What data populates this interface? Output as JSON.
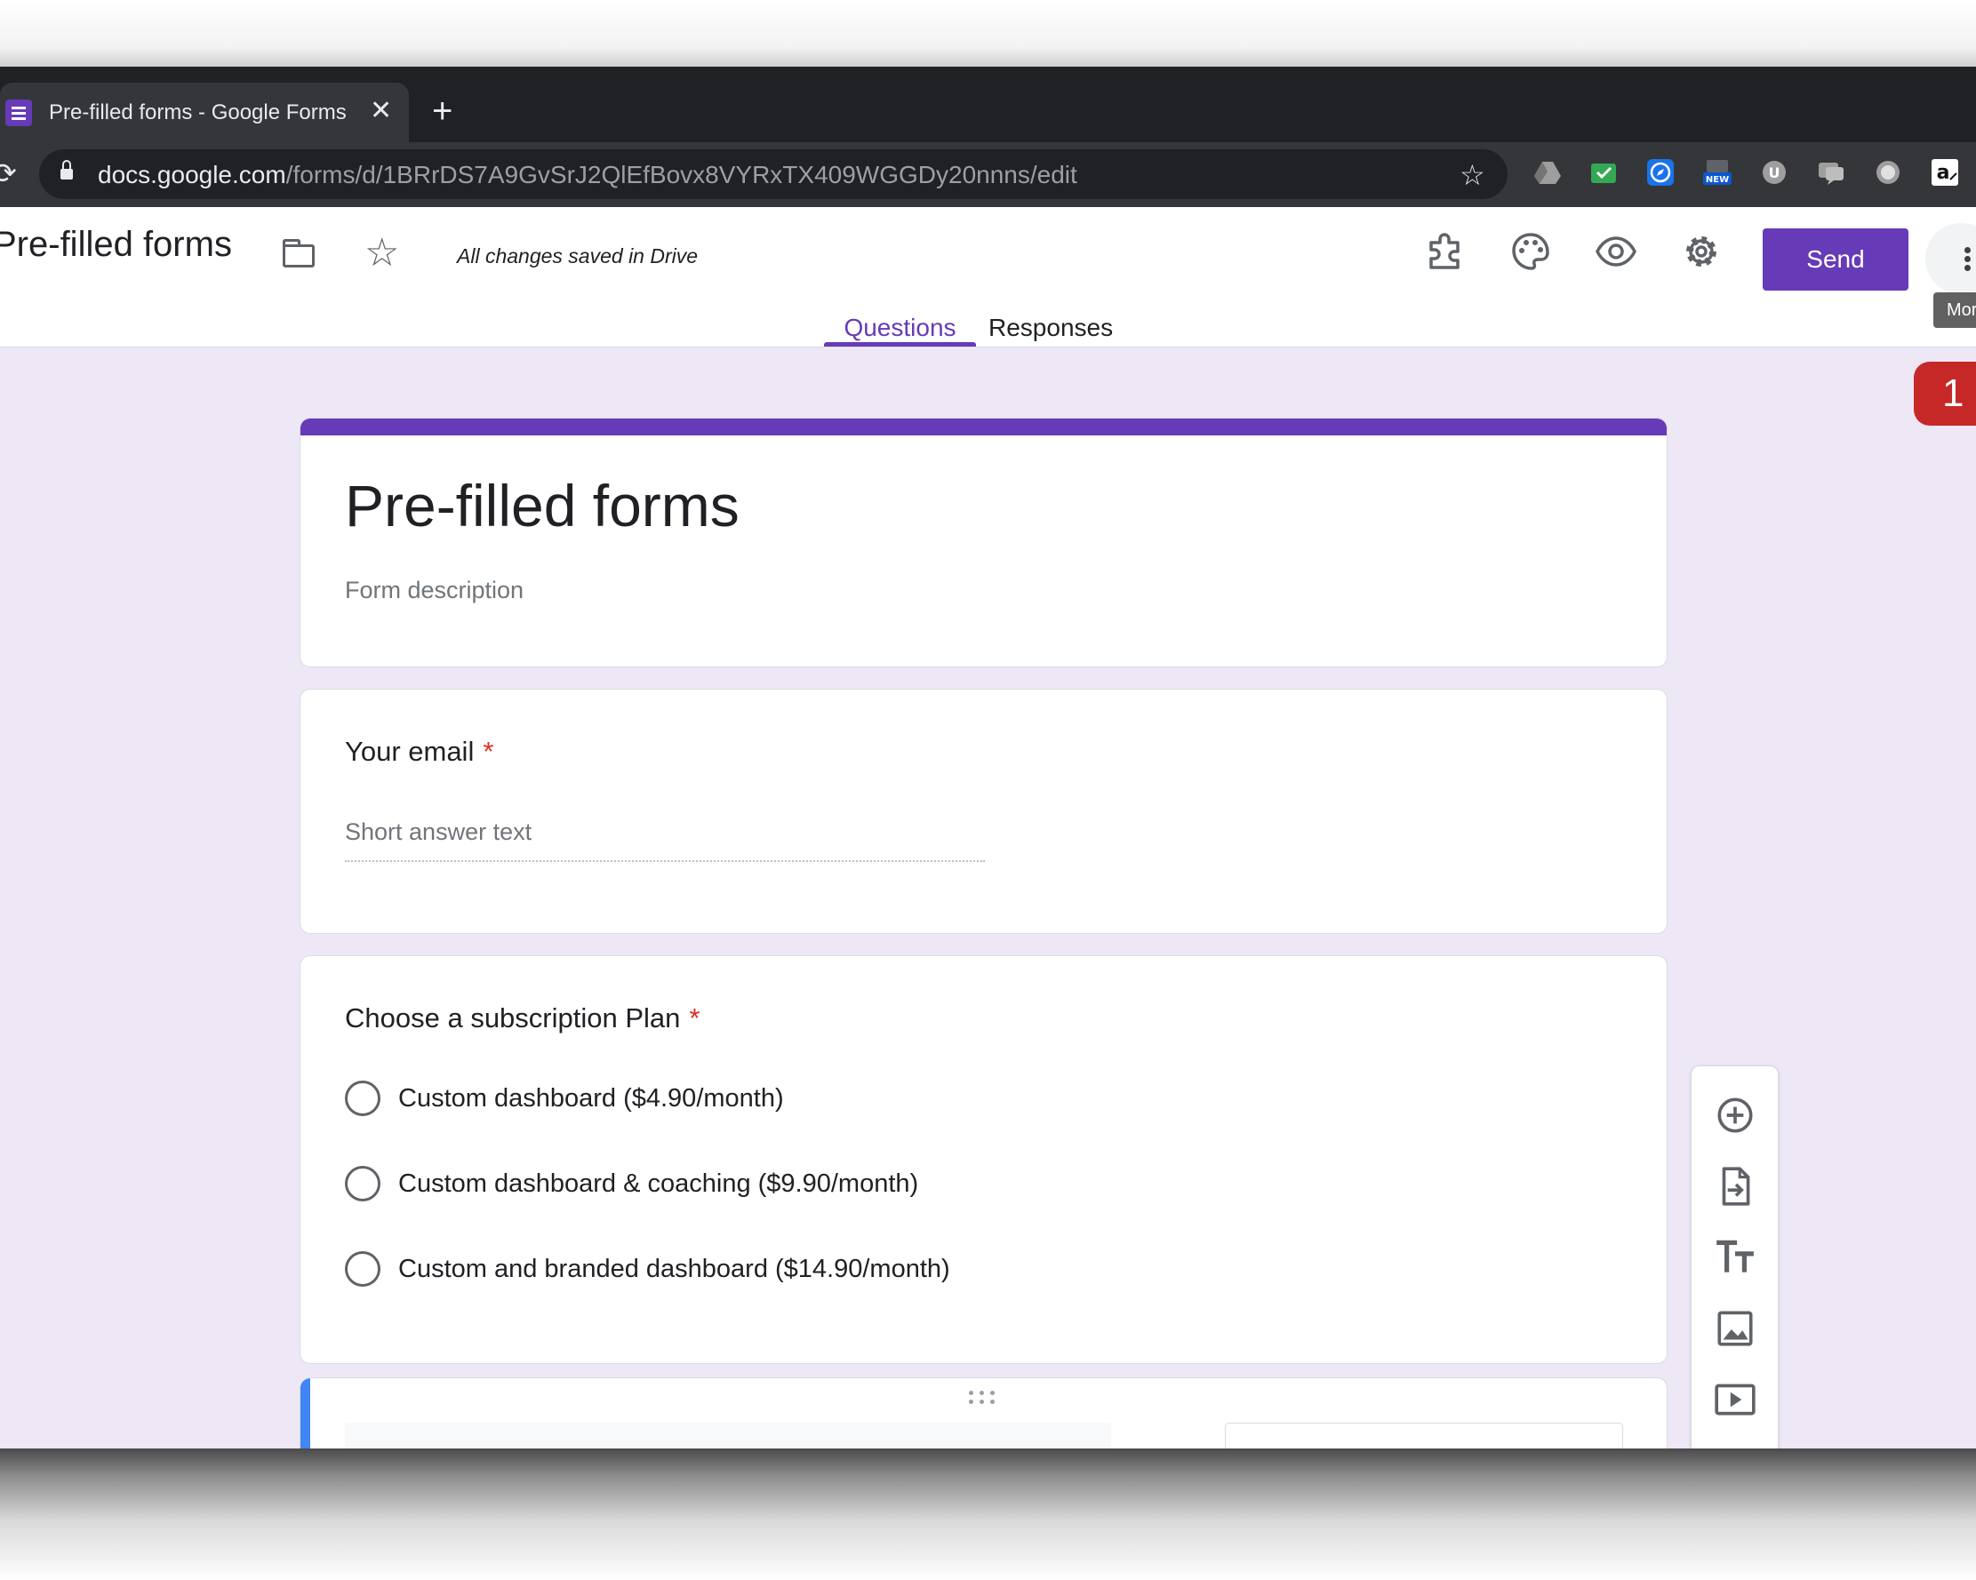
{
  "browser": {
    "tab_title": "Pre-filled forms - Google Forms",
    "tab_close": "✕",
    "new_tab": "+",
    "reload": "⟳",
    "url_host": "docs.google.com",
    "url_path": "/forms/d/1BRrDS7A9GvSrJ2QlEfBovx8VYRxTX409WGGDy20nnns/edit",
    "bookmark": "☆",
    "extensions": [
      {
        "name": "google-drive",
        "color": "#9e9e9e"
      },
      {
        "name": "mail-check",
        "color": "#34a853"
      },
      {
        "name": "compass",
        "color": "#1a73e8"
      },
      {
        "name": "new",
        "color": "#0b57d0"
      },
      {
        "name": "u-extension",
        "color": "#9e9e9e"
      },
      {
        "name": "chat",
        "color": "#9e9e9e"
      },
      {
        "name": "circle",
        "color": "#9e9e9e"
      },
      {
        "name": "amazon",
        "color": "#ffffff"
      }
    ]
  },
  "app": {
    "doc_title": "Pre-filled forms",
    "saved_status": "All changes saved in Drive",
    "send_label": "Send",
    "more_tooltip": "Mor",
    "tabs": {
      "questions": "Questions",
      "responses": "Responses"
    },
    "notification_count": "1",
    "accent_color": "#673ab7",
    "background_color": "#ede7f6"
  },
  "form": {
    "title": "Pre-filled forms",
    "description_placeholder": "Form description",
    "questions": [
      {
        "title": "Your email",
        "required_mark": "*",
        "answer_placeholder": "Short answer text"
      },
      {
        "title": "Choose a subscription Plan",
        "required_mark": "*",
        "options": [
          "Custom dashboard ($4.90/month)",
          "Custom dashboard & coaching ($9.90/month)",
          "Custom and branded dashboard ($14.90/month)"
        ]
      }
    ]
  },
  "side_toolbar": [
    "add-question-icon",
    "import-questions-icon",
    "add-title-icon",
    "add-image-icon",
    "add-video-icon",
    "add-section-icon"
  ]
}
